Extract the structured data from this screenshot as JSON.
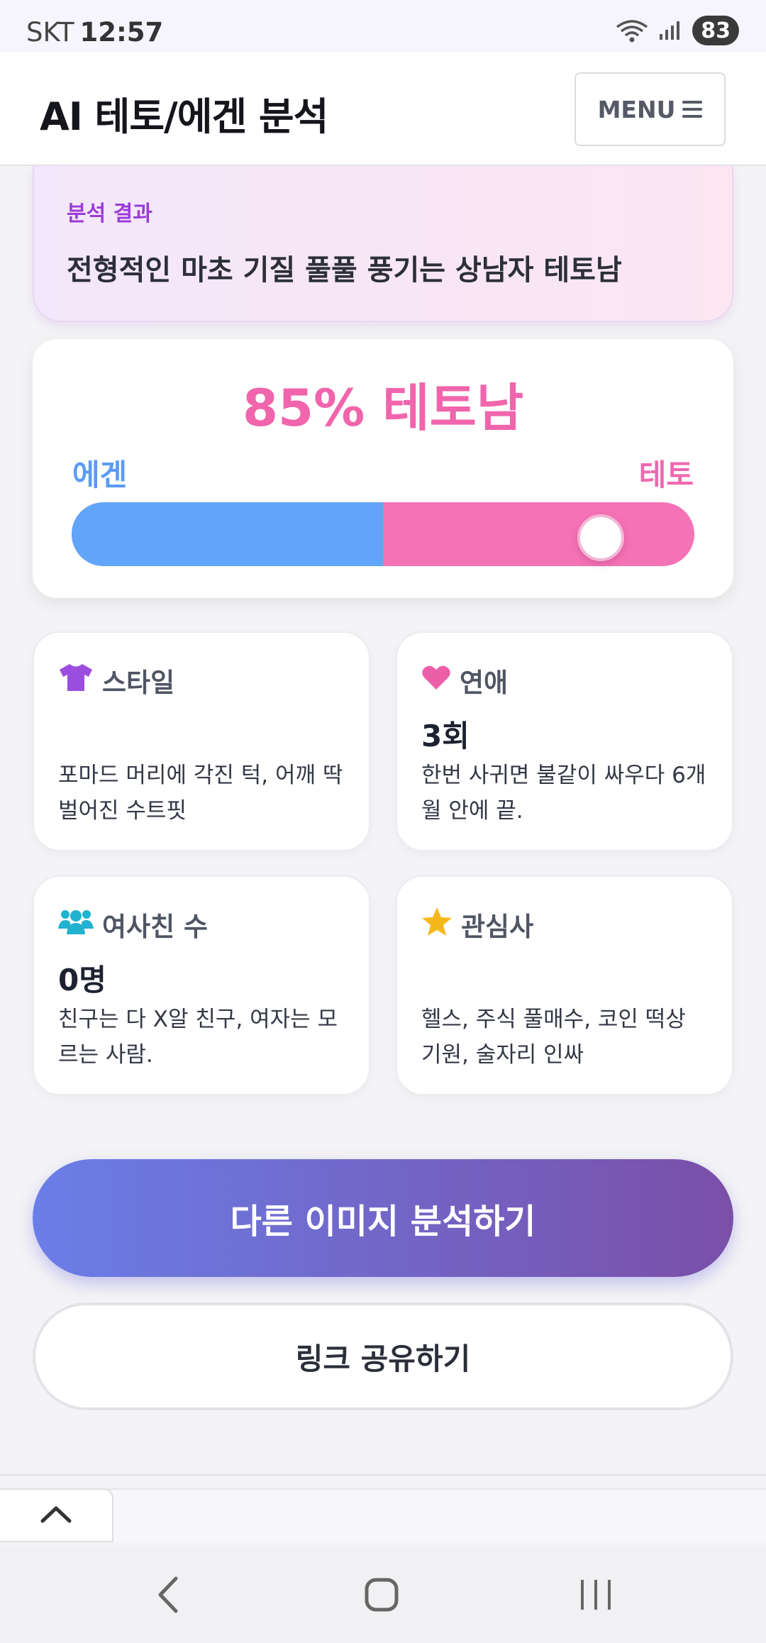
{
  "status_bar": {
    "carrier": "SKT",
    "time": "12:57",
    "battery": "83",
    "icons": [
      "wifi-icon",
      "signal-icon",
      "battery-icon"
    ]
  },
  "header": {
    "title": "AI 테토/에겐 분석",
    "menu_label": "MENU",
    "menu_icon": "hamburger-icon"
  },
  "result": {
    "label": "분석 결과",
    "text": "전형적인 마초 기질 풀풀 풍기는 상남자 테토남"
  },
  "score": {
    "title": "85% 테토남",
    "left_label": "에겐",
    "right_label": "테토",
    "teto_fraction": 0.85,
    "colors": {
      "egen": "#60a5fa",
      "teto": "#f472b6"
    }
  },
  "cards": [
    {
      "icon": "shirt-icon",
      "icon_color": "#9b4de0",
      "title": "스타일",
      "value": "",
      "desc": "포마드 머리에 각진 턱, 어깨 딱 벌어진 수트핏"
    },
    {
      "icon": "heart-icon",
      "icon_color": "#ec5fa8",
      "title": "연애",
      "value": "3회",
      "desc": "한번 사귀면 불같이 싸우다 6개월 안에 끝."
    },
    {
      "icon": "users-icon",
      "icon_color": "#20b2cf",
      "title": "여사친 수",
      "value": "0명",
      "desc": "친구는 다 X알 친구, 여자는 모르는 사람."
    },
    {
      "icon": "star-icon",
      "icon_color": "#f5b81b",
      "title": "관심사",
      "value": "",
      "desc": "헬스, 주식 풀매수, 코인 떡상 기원, 술자리 인싸"
    }
  ],
  "actions": {
    "primary": "다른 이미지 분석하기",
    "secondary": "링크 공유하기"
  },
  "bottom": {
    "scroll_top_icon": "chevron-up-icon",
    "nav": [
      "back-icon",
      "home-icon",
      "recents-icon"
    ]
  }
}
